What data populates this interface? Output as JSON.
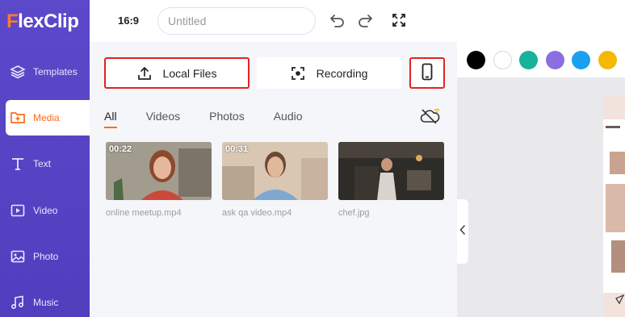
{
  "app": {
    "logo_first": "F",
    "logo_rest": "lexClip"
  },
  "sidebar": {
    "items": [
      {
        "label": "Templates",
        "icon": "layers-icon"
      },
      {
        "label": "Media",
        "icon": "media-folder-icon"
      },
      {
        "label": "Text",
        "icon": "text-icon"
      },
      {
        "label": "Video",
        "icon": "video-icon"
      },
      {
        "label": "Photo",
        "icon": "photo-icon"
      },
      {
        "label": "Music",
        "icon": "music-icon"
      }
    ]
  },
  "topbar": {
    "ratio": "16:9",
    "title_placeholder": "Untitled"
  },
  "media": {
    "local_files_label": "Local Files",
    "recording_label": "Recording",
    "tabs": [
      "All",
      "Videos",
      "Photos",
      "Audio"
    ],
    "items": [
      {
        "duration": "00:22",
        "name": "online meetup.mp4"
      },
      {
        "duration": "00:31",
        "name": "ask qa video.mp4"
      },
      {
        "duration": "",
        "name": "chef.jpg"
      }
    ]
  },
  "colors": {
    "swatches": [
      "#000000",
      "#ffffff",
      "#16b39a",
      "#8b6ee0",
      "#1aa1f0",
      "#f5b800"
    ],
    "accent": "#ff6b1a",
    "sidebar": "#5b49c9",
    "highlight": "#e02424"
  }
}
